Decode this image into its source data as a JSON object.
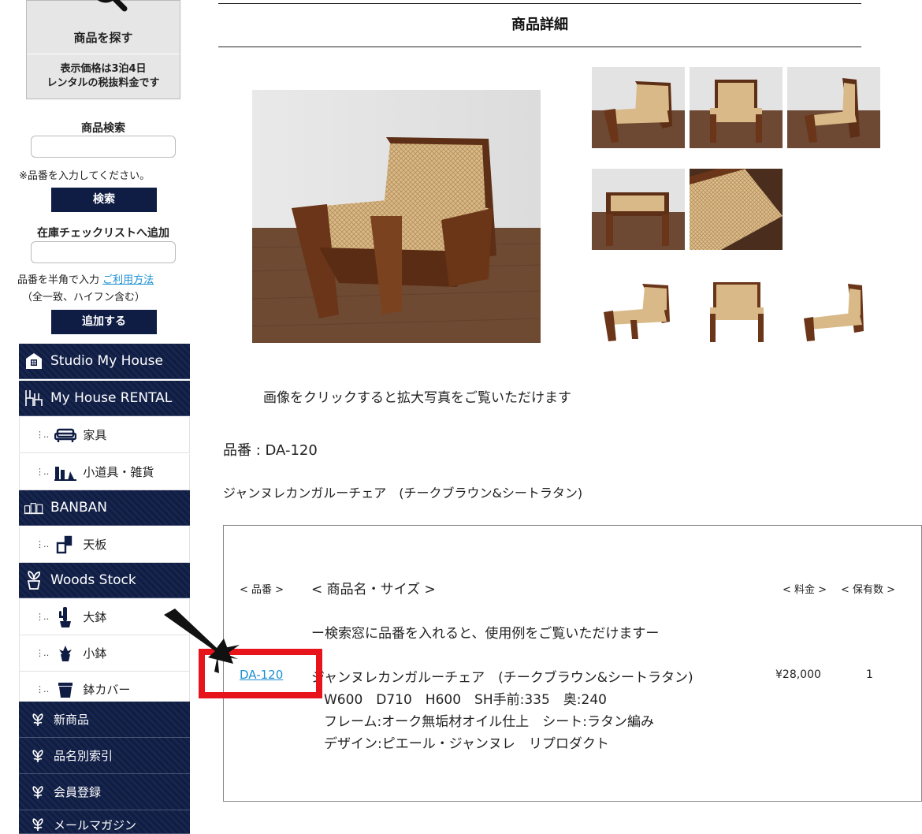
{
  "sidebar": {
    "find_label": "商品を探す",
    "price_note_line1": "表示価格は3泊4日",
    "price_note_line2": "レンタルの税抜料金です",
    "search_heading": "商品検索",
    "search_note": "※品番を入力してください。",
    "search_button": "検索",
    "stock_heading": "在庫チェックリストへ追加",
    "stock_note_prefix": "品番を半角で入力 ",
    "usage_link": "ご利用方法",
    "stock_note2": "（全一致、ハイフン含む）",
    "add_button": "追加する",
    "nav": {
      "studio": "Studio My House",
      "rental": "My House RENTAL",
      "furniture": "家具",
      "small_goods": "小道具・雑貨",
      "banban": "BANBAN",
      "tabletop": "天板",
      "woods": "Woods Stock",
      "large_pot": "大鉢",
      "small_pot": "小鉢",
      "pot_cover": "鉢カバー",
      "new_items": "新商品",
      "index": "品名別索引",
      "member": "会員登録",
      "magazine": "メールマガジン"
    }
  },
  "main": {
    "title": "商品詳細",
    "click_note": "画像をクリックすると拡大写真をご覧いただけます",
    "item_code_line": "品番 : DA-120",
    "item_name": "ジャンヌレカンガルーチェア　(チークブラウン&シートラタン)",
    "table": {
      "col_code": "< 品番 >",
      "col_name": "< 商品名・サイズ >",
      "col_price": "< 料金 >",
      "col_stock": "< 保有数 >",
      "hint": "ー検索窓に品番を入れると、使用例をご覧いただけますー",
      "row": {
        "code": "DA-120",
        "name": "ジャンヌレカンガルーチェア　(チークブラウン&シートラタン)",
        "size": "W600　D710　H600　SH手前:335　奥:240",
        "material": "フレーム:オーク無垢材オイル仕上　シート:ラタン編み",
        "design": "デザイン:ピエール・ジャンヌレ　リプロダクト",
        "price": "¥28,000",
        "qty": "1"
      }
    }
  },
  "colors": {
    "navy": "#0f1d45",
    "link": "#1a8fd4",
    "highlight": "#e8141b"
  }
}
